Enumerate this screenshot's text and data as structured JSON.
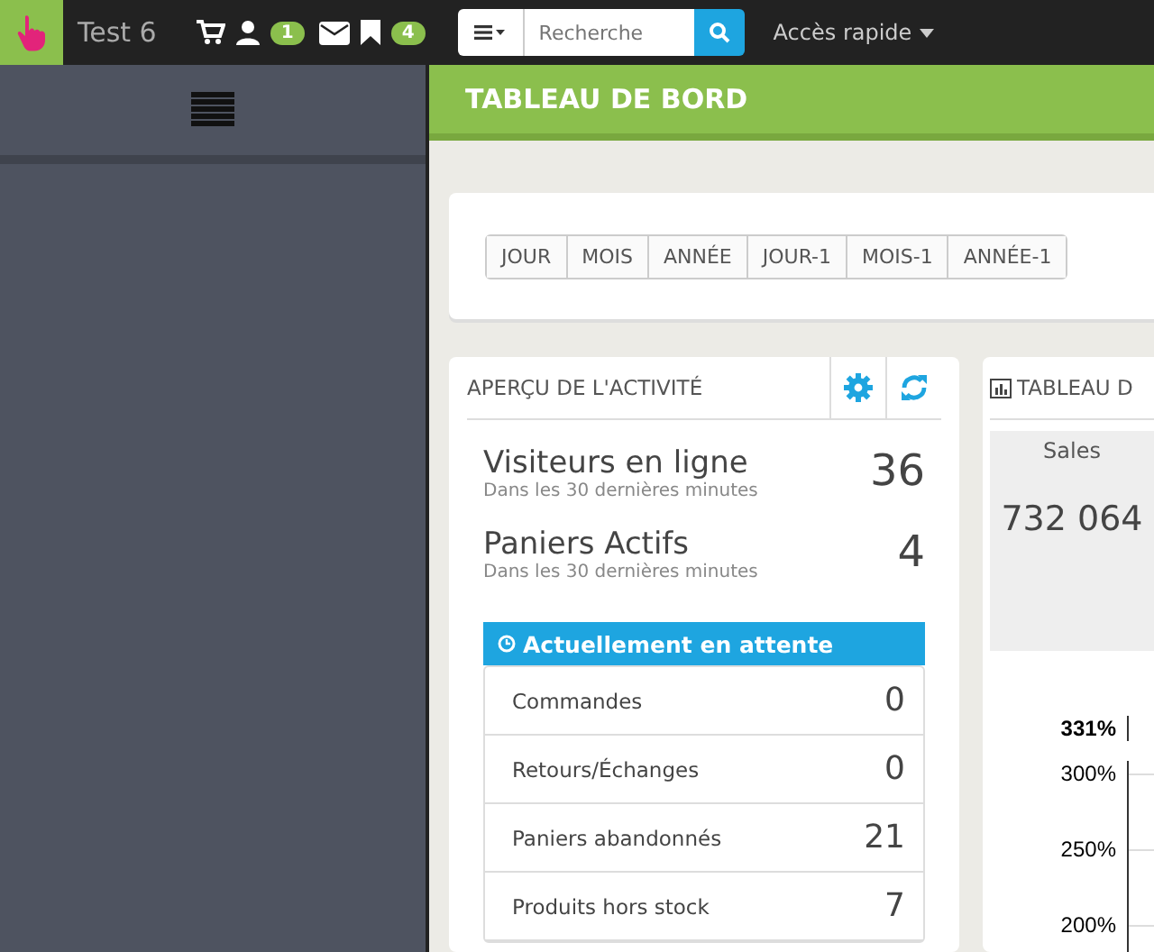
{
  "topbar": {
    "shop_name": "Test 6",
    "customer_badge": "1",
    "orders_badge": "4",
    "search": {
      "placeholder": "Recherche"
    },
    "quick_access": "Accès rapide"
  },
  "page_title": "TABLEAU DE BORD",
  "periods": [
    {
      "label": "JOUR",
      "selected": false
    },
    {
      "label": "MOIS",
      "selected": false
    },
    {
      "label": "ANNÉE",
      "selected": false
    },
    {
      "label": "JOUR-1",
      "selected": false
    },
    {
      "label": "MOIS-1",
      "selected": false
    },
    {
      "label": "ANNÉE-1",
      "selected": false
    }
  ],
  "activity": {
    "title": "APERÇU DE L'ACTIVITÉ",
    "stats": [
      {
        "label": "Visiteurs en ligne",
        "sub": "Dans les 30 dernières minutes",
        "value": "36"
      },
      {
        "label": "Paniers Actifs",
        "sub": "Dans les 30 dernières minutes",
        "value": "4"
      }
    ],
    "pending_title": "Actuellement en attente",
    "pending": [
      {
        "label": "Commandes",
        "value": "0"
      },
      {
        "label": "Retours/Échanges",
        "value": "0"
      },
      {
        "label": "Paniers abandonnés",
        "value": "21"
      },
      {
        "label": "Produits hors stock",
        "value": "7"
      }
    ]
  },
  "dashboard": {
    "title": "TABLEAU D",
    "sales_label": "Sales",
    "sales_value": "732 064",
    "y_labels": [
      {
        "text": "331%",
        "bold": true
      },
      {
        "text": "300%",
        "bold": false
      },
      {
        "text": "250%",
        "bold": false
      },
      {
        "text": "200%",
        "bold": false
      }
    ]
  }
}
